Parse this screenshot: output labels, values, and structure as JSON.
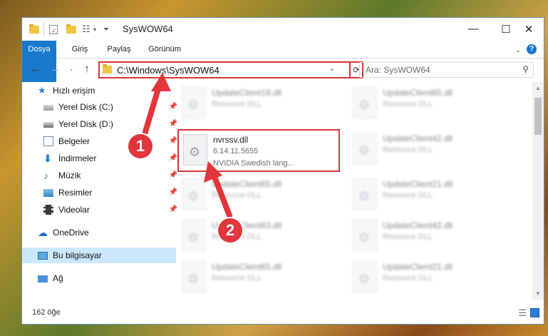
{
  "window": {
    "title": "SysWOW64"
  },
  "ribbon": {
    "tabs": [
      "Dosya",
      "Giriş",
      "Paylaş",
      "Görünüm"
    ]
  },
  "address": {
    "path": "C:\\Windows\\SysWOW64",
    "search_placeholder": "Ara: SysWOW64"
  },
  "sidebar": {
    "items": [
      {
        "label": "Hızlı erişim",
        "icon": "star-icon",
        "pinned": false
      },
      {
        "label": "Yerel Disk (C:)",
        "icon": "drive-icon",
        "pinned": true
      },
      {
        "label": "Yerel Disk (D:)",
        "icon": "drive-icon",
        "pinned": true
      },
      {
        "label": "Belgeler",
        "icon": "documents-icon",
        "pinned": true
      },
      {
        "label": "İndirmeler",
        "icon": "download-icon",
        "pinned": true
      },
      {
        "label": "Müzik",
        "icon": "music-icon",
        "pinned": true
      },
      {
        "label": "Resimler",
        "icon": "pictures-icon",
        "pinned": true
      },
      {
        "label": "Videolar",
        "icon": "video-icon",
        "pinned": true
      },
      {
        "label": "OneDrive",
        "icon": "cloud-icon",
        "pinned": false
      },
      {
        "label": "Bu bilgisayar",
        "icon": "computer-icon",
        "pinned": false
      },
      {
        "label": "Ağ",
        "icon": "network-icon",
        "pinned": false
      }
    ]
  },
  "files": {
    "left": [
      {
        "name": "UpdateClient19.dll",
        "desc": "Resource DLL"
      },
      {
        "name": "nvrssv.dll",
        "version": "6.14.11.5655",
        "desc": "NVIDIA Swedish lang..."
      },
      {
        "name": "UpdateClient65.dll",
        "desc": "Resource DLL"
      },
      {
        "name": "UpdateClient63.dll",
        "desc": "Resource DLL"
      },
      {
        "name": "UpdateClient65.dll",
        "desc": "Resource DLL"
      }
    ],
    "right": [
      {
        "name": "UpdateClient65.dll",
        "desc": "Resource DLL"
      },
      {
        "name": "UpdateClient42.dll",
        "desc": "Resource DLL"
      },
      {
        "name": "UpdateClient21.dll",
        "desc": "Resource DLL"
      },
      {
        "name": "UpdateClient42.dll",
        "desc": "Resource DLL"
      },
      {
        "name": "UpdateClient21.dll",
        "desc": "Resource DLL"
      }
    ]
  },
  "status": {
    "count": "162 öğe"
  },
  "annotations": {
    "step1": "1",
    "step2": "2",
    "color": "#e0363c"
  }
}
